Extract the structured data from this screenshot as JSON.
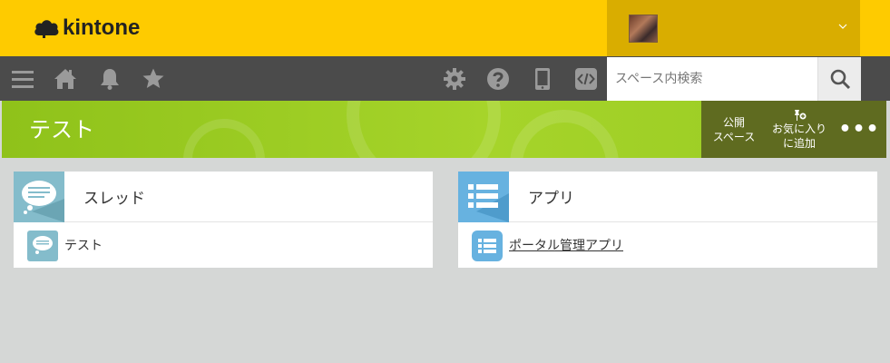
{
  "header": {
    "logo_text": "kintone",
    "brand_color": "#fecb00"
  },
  "user": {
    "avatar": "user-avatar-photo",
    "menu_icon": "chevron-down-icon"
  },
  "toolbar": {
    "icons": [
      "menu-icon",
      "home-icon",
      "bell-icon",
      "star-icon",
      "gear-icon",
      "help-icon",
      "mobile-icon",
      "code-icon"
    ],
    "search": {
      "placeholder": "スペース内検索",
      "value": ""
    }
  },
  "space": {
    "title": "テスト",
    "banner_color": "#9acb24",
    "actions": {
      "public": [
        "公開",
        "スペース"
      ],
      "favorite": [
        "お気に入り",
        "に追加"
      ],
      "more": "•••"
    }
  },
  "panels": {
    "threads": {
      "title": "スレッド",
      "icon": "thread-icon",
      "items": [
        {
          "label": "テスト",
          "icon": "thread-icon"
        }
      ]
    },
    "apps": {
      "title": "アプリ",
      "icon": "app-list-icon",
      "items": [
        {
          "label": "ポータル管理アプリ",
          "icon": "app-list-icon"
        }
      ]
    }
  }
}
